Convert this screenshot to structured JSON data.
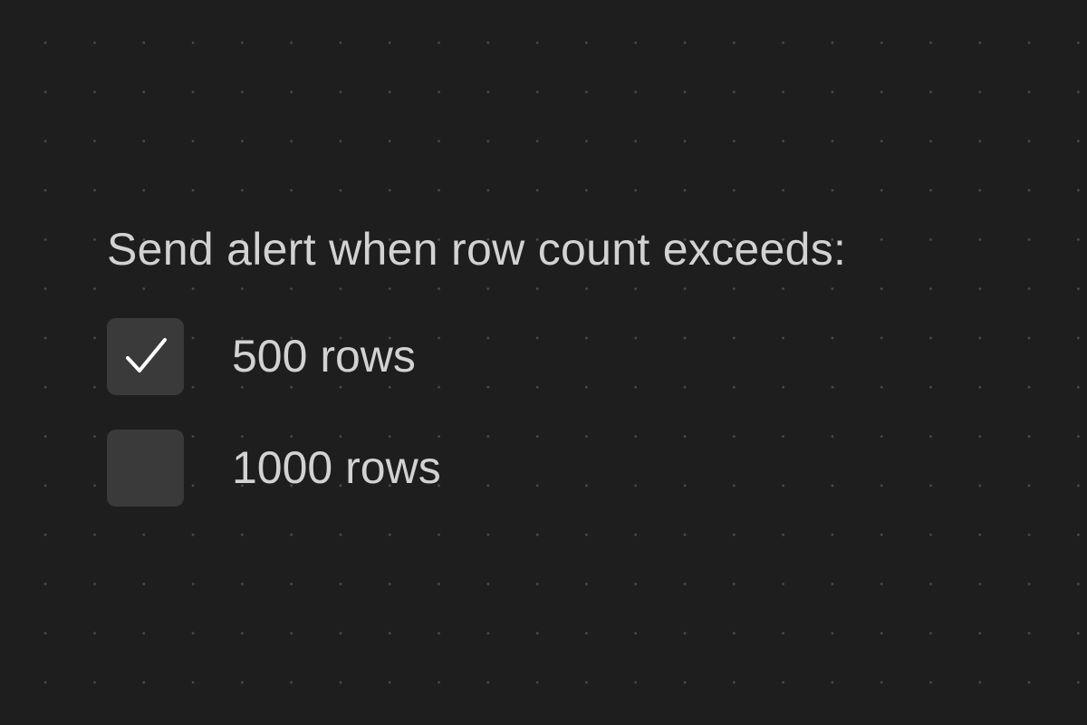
{
  "prompt": "Send alert when row count exceeds:",
  "options": [
    {
      "label": "500 rows",
      "checked": true,
      "icon": "check-icon"
    },
    {
      "label": "1000 rows",
      "checked": false
    }
  ],
  "colors": {
    "background": "#1e1e1e",
    "text": "#d2d2d2",
    "checkbox": "#3a3a3a",
    "check": "#ffffff",
    "grid_dot": "#4a4a4a"
  }
}
